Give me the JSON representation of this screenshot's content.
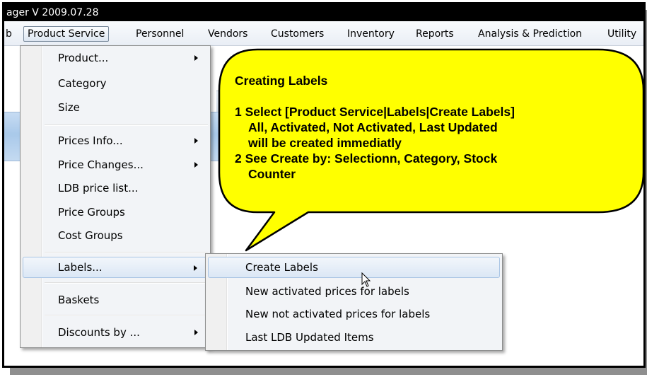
{
  "window": {
    "title": "ager V 2009.07.28"
  },
  "menubar": {
    "items": [
      {
        "label": "b"
      },
      {
        "label": "Product Service"
      },
      {
        "label": "Personnel"
      },
      {
        "label": "Vendors"
      },
      {
        "label": "Customers"
      },
      {
        "label": "Inventory"
      },
      {
        "label": "Reports"
      },
      {
        "label": "Analysis & Prediction"
      },
      {
        "label": "Utility"
      }
    ],
    "active": "Product Service"
  },
  "product_menu": {
    "items": [
      {
        "label": "Product...",
        "submenu": true
      },
      {
        "label": "Category",
        "submenu": false
      },
      {
        "label": "Size",
        "submenu": false
      },
      {
        "label": "Prices Info...",
        "submenu": true
      },
      {
        "label": "Price Changes...",
        "submenu": true
      },
      {
        "label": "LDB price list...",
        "submenu": false
      },
      {
        "label": "Price Groups",
        "submenu": false
      },
      {
        "label": "Cost Groups",
        "submenu": false
      },
      {
        "label": "Labels...",
        "submenu": true,
        "highlighted": true
      },
      {
        "label": "Baskets",
        "submenu": false
      },
      {
        "label": "Discounts by ...",
        "submenu": true
      }
    ]
  },
  "labels_submenu": {
    "items": [
      {
        "label": "Create Labels",
        "highlighted": true
      },
      {
        "label": "New activated prices for labels"
      },
      {
        "label": "New not activated prices for labels"
      },
      {
        "label": "Last LDB Updated Items"
      }
    ]
  },
  "callout": {
    "title": "Creating Labels",
    "lines": [
      "1 Select [Product Service|Labels|Create Labels]",
      "All, Activated, Not Activated, Last Updated",
      "will be created immediatly",
      "2 See Create by: Selectionn, Category, Stock",
      "Counter"
    ],
    "fill": "#ffff00",
    "stroke": "#000000"
  },
  "colors": {
    "accent_highlight": "#dbe7f5",
    "menu_bg": "#f2f4f7",
    "titlebar": "#000000"
  },
  "icons": {
    "cursor": "arrow-cursor-icon"
  }
}
